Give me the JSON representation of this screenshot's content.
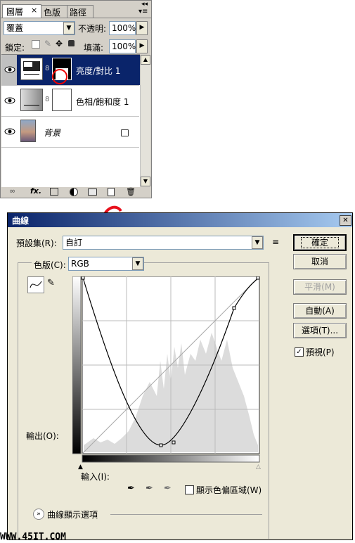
{
  "layers_panel": {
    "tabs": [
      "圖層",
      "色版",
      "路徑"
    ],
    "tab_close": "×",
    "blend_mode": "覆蓋",
    "opacity_label": "不透明:",
    "opacity_value": "100%",
    "lock_label": "鎖定:",
    "fill_label": "填滿:",
    "fill_value": "100%",
    "layers": [
      {
        "name": "亮度/對比 1",
        "selected": true
      },
      {
        "name": "色相/飽和度 1",
        "selected": false
      },
      {
        "name": "背景",
        "selected": false
      }
    ],
    "footer_fx": "fx."
  },
  "curves_dialog": {
    "title": "曲線",
    "close": "✕",
    "preset_label": "預設集(R):",
    "preset_value": "自訂",
    "channel_label": "色版(C):",
    "channel_value": "RGB",
    "output_label": "輸出(O):",
    "input_label": "輸入(I):",
    "show_clipping": "顯示色偏區域(W)",
    "curve_options": "曲線顯示選項",
    "buttons": {
      "ok": "確定",
      "cancel": "取消",
      "smooth": "平滑(M)",
      "auto": "自動(A)",
      "options": "選項(T)..."
    },
    "preview_label": "預視(P)",
    "preview_checked": true
  },
  "watermark": "WWW.45IT.COM",
  "colors": {
    "title_bar": "#0a246a",
    "selected_layer": "#0a246a",
    "dialog_bg": "#ece9d8"
  }
}
